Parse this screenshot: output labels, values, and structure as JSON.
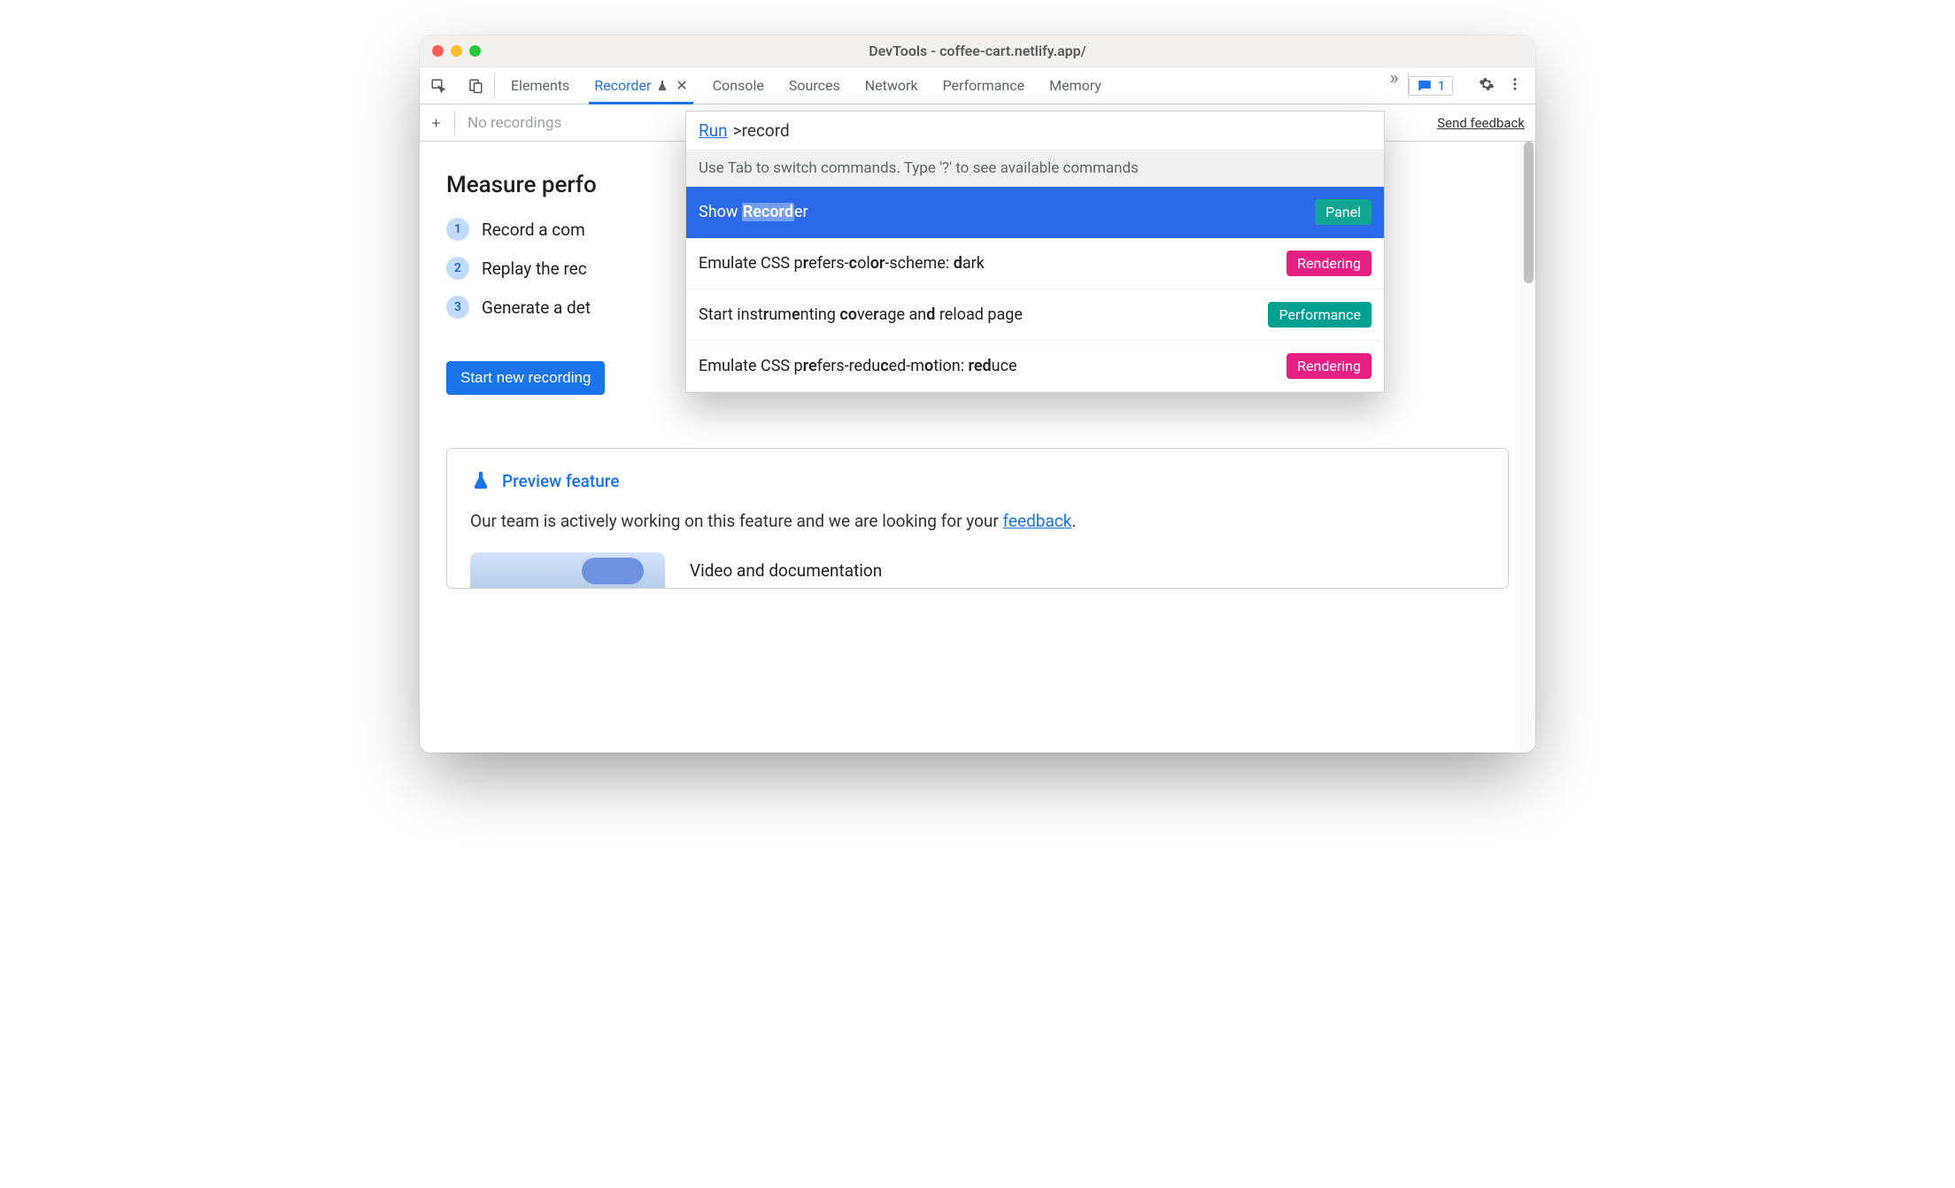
{
  "window": {
    "title": "DevTools - coffee-cart.netlify.app/"
  },
  "toolbar": {
    "tabs": [
      "Elements",
      "Recorder",
      "Console",
      "Sources",
      "Network",
      "Performance",
      "Memory"
    ],
    "active_index": 1,
    "message_count": "1"
  },
  "secondary": {
    "empty_label": "No recordings",
    "feedback_link": "Send feedback"
  },
  "page": {
    "heading": "Measure perfo",
    "steps": [
      {
        "num": "1",
        "text": "Record a com"
      },
      {
        "num": "2",
        "text": "Replay the rec"
      },
      {
        "num": "3",
        "text": "Generate a det"
      }
    ],
    "primary_button": "Start new recording",
    "preview": {
      "badge": "Preview feature",
      "text_before": "Our team is actively working on this feature and we are looking for your ",
      "link": "feedback",
      "text_after": ".",
      "media_title": "Video and documentation"
    }
  },
  "command_menu": {
    "run_label": "Run",
    "prefix": ">",
    "query": "record",
    "hint": "Use Tab to switch commands. Type '?' to see available commands",
    "items": [
      {
        "html": "Show <span class='highlight'><b>Record</b></span>er",
        "badge": "Panel",
        "badge_class": "panel",
        "selected": true
      },
      {
        "html": "Emulate CSS p<b>r</b>efers-<b>c</b>ol<b>or</b>-scheme: <b>d</b>ark",
        "badge": "Rendering",
        "badge_class": "rendering"
      },
      {
        "html": "Start inst<b>r</b>um<b>e</b>nting <b>co</b>ve<b>r</b>age an<b>d</b> reload page",
        "badge": "Performance",
        "badge_class": "performance"
      },
      {
        "html": "Emulate CSS p<b>re</b>fers-redu<b>c</b>ed-m<b>o</b>tion: <b>red</b>uce",
        "badge": "Rendering",
        "badge_class": "rendering"
      }
    ]
  }
}
